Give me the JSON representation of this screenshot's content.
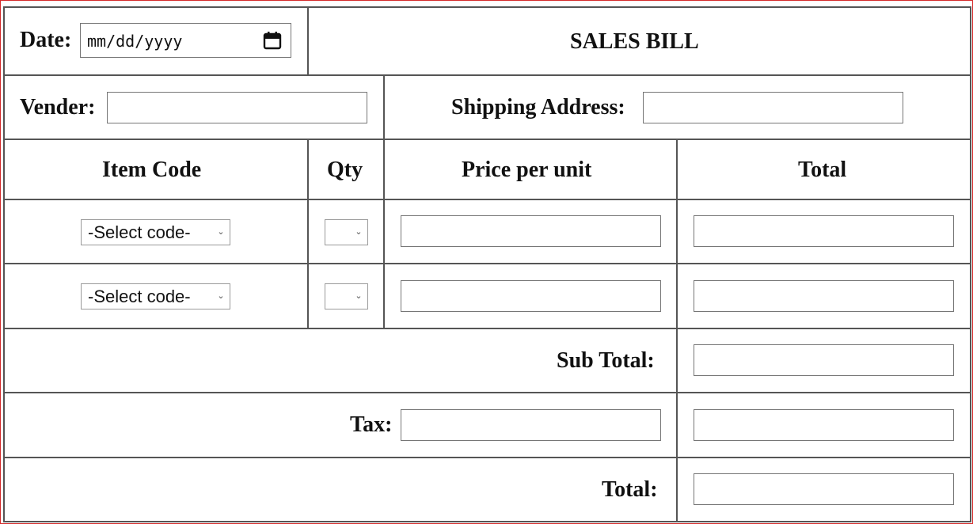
{
  "header": {
    "date_label": "Date:",
    "date_placeholder": "mm/dd/yyyy",
    "title": "SALES BILL"
  },
  "vendor": {
    "label": "Vender:",
    "value": ""
  },
  "shipping": {
    "label": "Shipping Address:",
    "value": ""
  },
  "columns": [
    "Item Code",
    "Qty",
    "Price per unit",
    "Total"
  ],
  "rows": [
    {
      "item_code": "-Select code-",
      "qty": "",
      "price": "",
      "total": ""
    },
    {
      "item_code": "-Select code-",
      "qty": "",
      "price": "",
      "total": ""
    }
  ],
  "summary": {
    "subtotal_label": "Sub Total:",
    "tax_label": "Tax:",
    "total_label": "Total:"
  },
  "icons": {
    "date_picker": "calendar-icon",
    "dropdown": "chevron-down-icon"
  },
  "colors": {
    "outer_border": "#d42a2a",
    "grid": "#555555",
    "field_border": "#767676"
  }
}
